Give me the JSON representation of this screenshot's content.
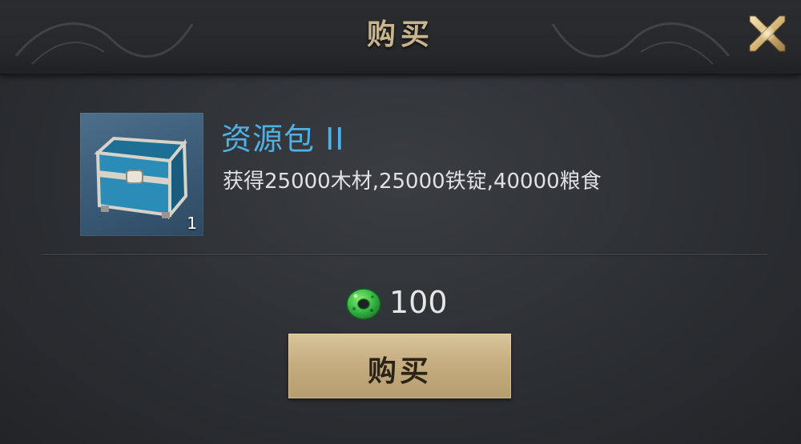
{
  "dialog": {
    "title": "购买",
    "close_icon": "close-icon"
  },
  "item": {
    "name": "资源包 II",
    "description": "获得25000木材,25000铁锭,40000粮食",
    "count": "1",
    "icon": "treasure-chest-icon"
  },
  "price": {
    "currency_icon": "jade-currency-icon",
    "amount": "100"
  },
  "buy_button": {
    "label": "购买"
  },
  "colors": {
    "title": "#c9b58d",
    "item_name": "#4fb0e4",
    "button_gold": "#c5ad80",
    "jade_green": "#3cc24a"
  }
}
